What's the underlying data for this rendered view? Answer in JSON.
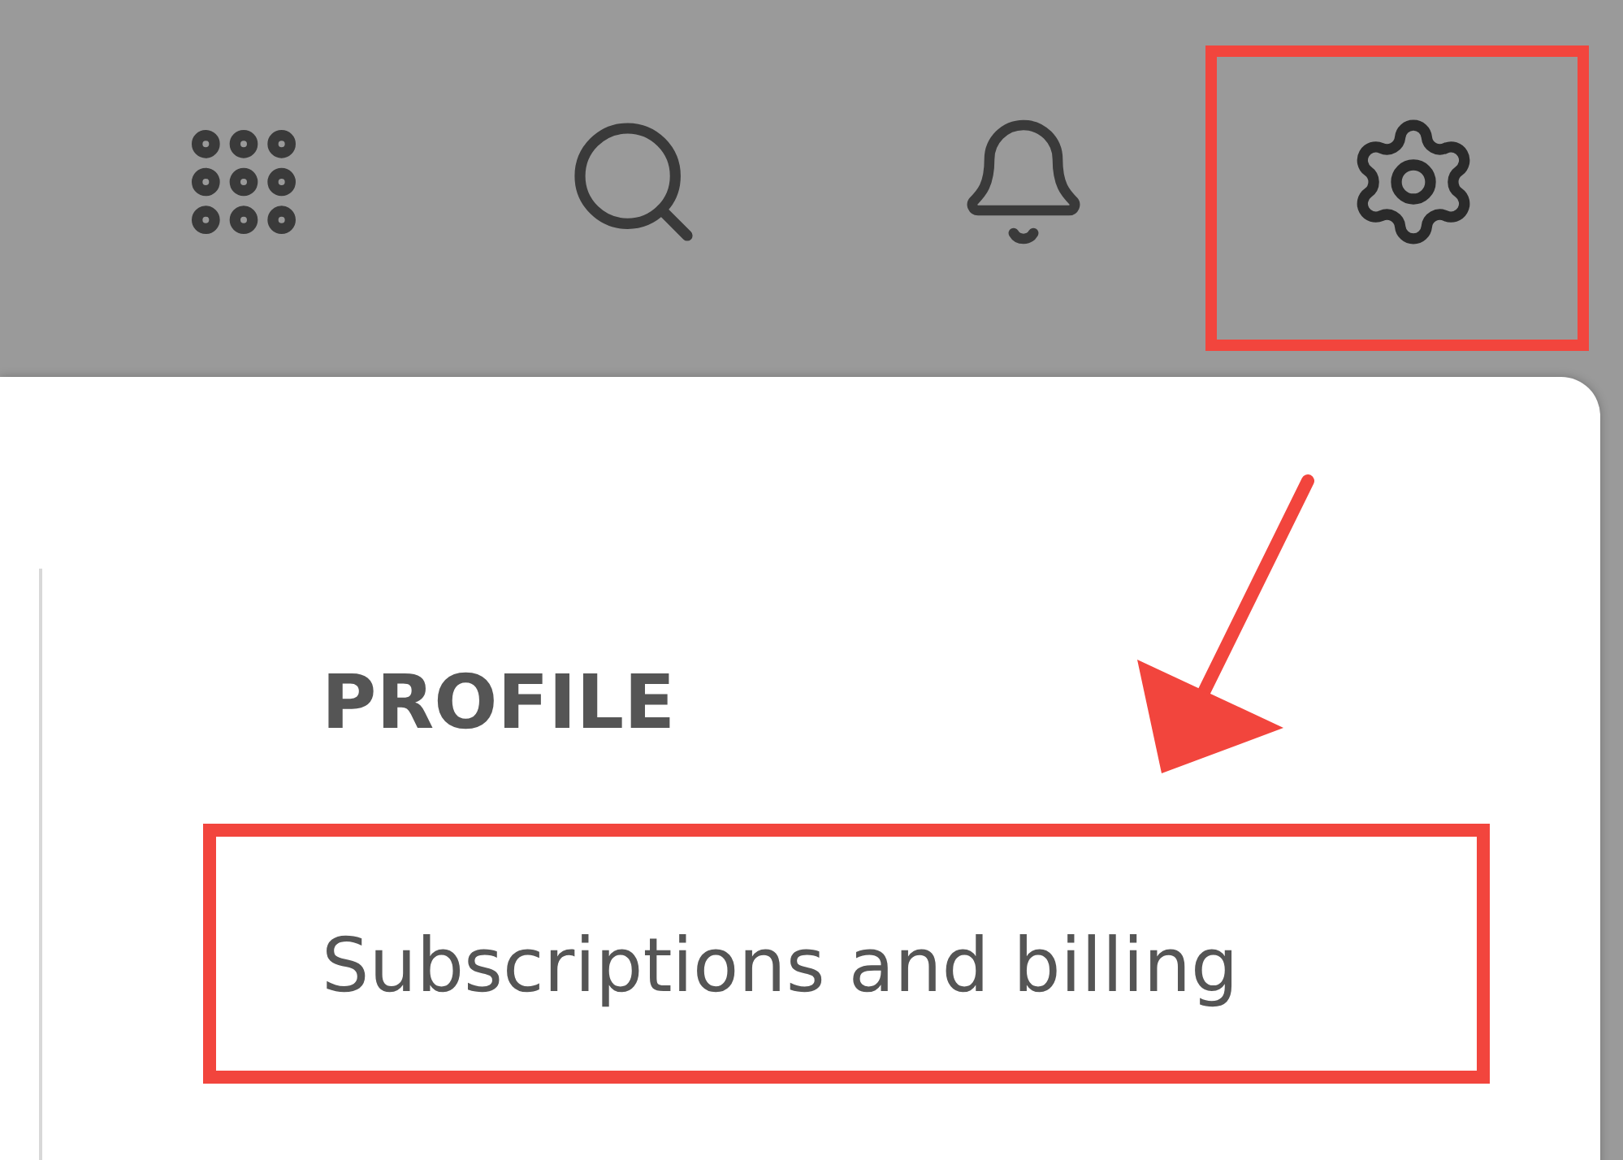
{
  "profile_menu": {
    "heading": "PROFILE",
    "items": [
      {
        "label": "Subscriptions and billing"
      }
    ]
  }
}
